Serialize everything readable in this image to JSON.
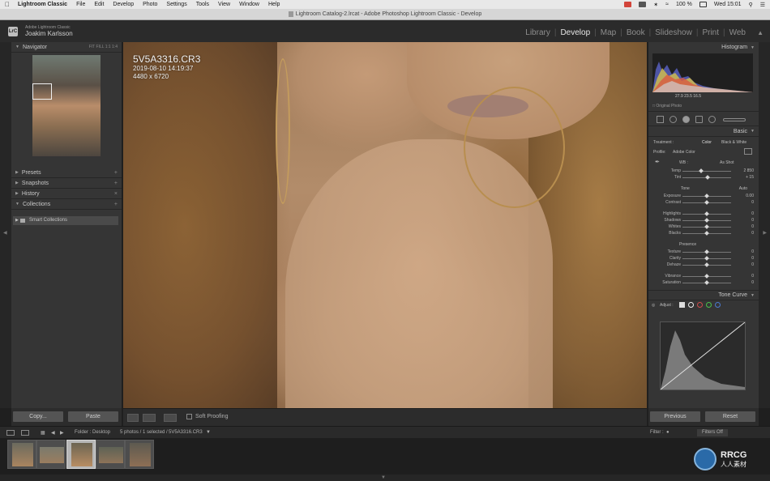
{
  "menubar": {
    "app": "Lightroom Classic",
    "items": [
      "File",
      "Edit",
      "Develop",
      "Photo",
      "Settings",
      "Tools",
      "View",
      "Window",
      "Help"
    ],
    "battery": "100 %",
    "clock": "Wed 15:01"
  },
  "window": {
    "title": "Lightroom Catalog-2.lrcat - Adobe Photoshop Lightroom Classic - Develop"
  },
  "identity": {
    "product": "Adobe Lightroom Classic",
    "user": "Joakim Karlsson",
    "logo": "LrC"
  },
  "modules": [
    {
      "label": "Library",
      "active": false
    },
    {
      "label": "Develop",
      "active": true
    },
    {
      "label": "Map",
      "active": false
    },
    {
      "label": "Book",
      "active": false
    },
    {
      "label": "Slideshow",
      "active": false
    },
    {
      "label": "Print",
      "active": false
    },
    {
      "label": "Web",
      "active": false
    }
  ],
  "left": {
    "navigator": "Navigator",
    "navigator_opts": "FIT  FILL  1:1  1:4",
    "panels": [
      "Presets",
      "Snapshots",
      "History",
      "Collections"
    ],
    "smart_collections": "Smart Collections",
    "copy": "Copy...",
    "paste": "Paste"
  },
  "image": {
    "filename": "5V5A3316.CR3",
    "datetime": "2019-08-10 14:19:37",
    "dimensions": "4480 x 6720"
  },
  "toolbar": {
    "soft_proofing": "Soft Proofing"
  },
  "right": {
    "histogram": "Histogram",
    "hist_values": "27.9   23.5   16.5",
    "original_photo": "Original Photo",
    "basic": "Basic",
    "treatment": "Treatment :",
    "treat_color": "Color",
    "treat_bw": "Black & White",
    "profile": "Profile:",
    "profile_value": "Adobe Color",
    "wb": "WB :",
    "wb_value": "As Shot",
    "temp": {
      "label": "Temp",
      "value": "2 850"
    },
    "tint": {
      "label": "Tint",
      "value": "+ 15"
    },
    "tone": "Tone",
    "auto": "Auto",
    "exposure": {
      "label": "Exposure",
      "value": "0.00"
    },
    "contrast": {
      "label": "Contrast",
      "value": "0"
    },
    "highlights": {
      "label": "Highlights",
      "value": "0"
    },
    "shadows": {
      "label": "Shadows",
      "value": "0"
    },
    "whites": {
      "label": "Whites",
      "value": "0"
    },
    "blacks": {
      "label": "Blacks",
      "value": "0"
    },
    "presence": "Presence",
    "texture": {
      "label": "Texture",
      "value": "0"
    },
    "clarity": {
      "label": "Clarity",
      "value": "0"
    },
    "dehaze": {
      "label": "Dehaze",
      "value": "0"
    },
    "vibrance": {
      "label": "Vibrance",
      "value": "0"
    },
    "saturation": {
      "label": "Saturation",
      "value": "0"
    },
    "tone_curve": "Tone Curve",
    "adjust": "Adjust :",
    "previous": "Previous",
    "reset": "Reset"
  },
  "filmbar": {
    "source": "Folder : Desktop",
    "count": "5 photos / 1 selected /",
    "selected": "5V5A3316.CR3",
    "filter": "Filter :",
    "filter_value": "Filters Off"
  },
  "watermark": {
    "brand": "RRCG",
    "sub": "人人素材"
  },
  "colors": {
    "accent_blue": "#2a6aa8",
    "panel": "#353535"
  }
}
